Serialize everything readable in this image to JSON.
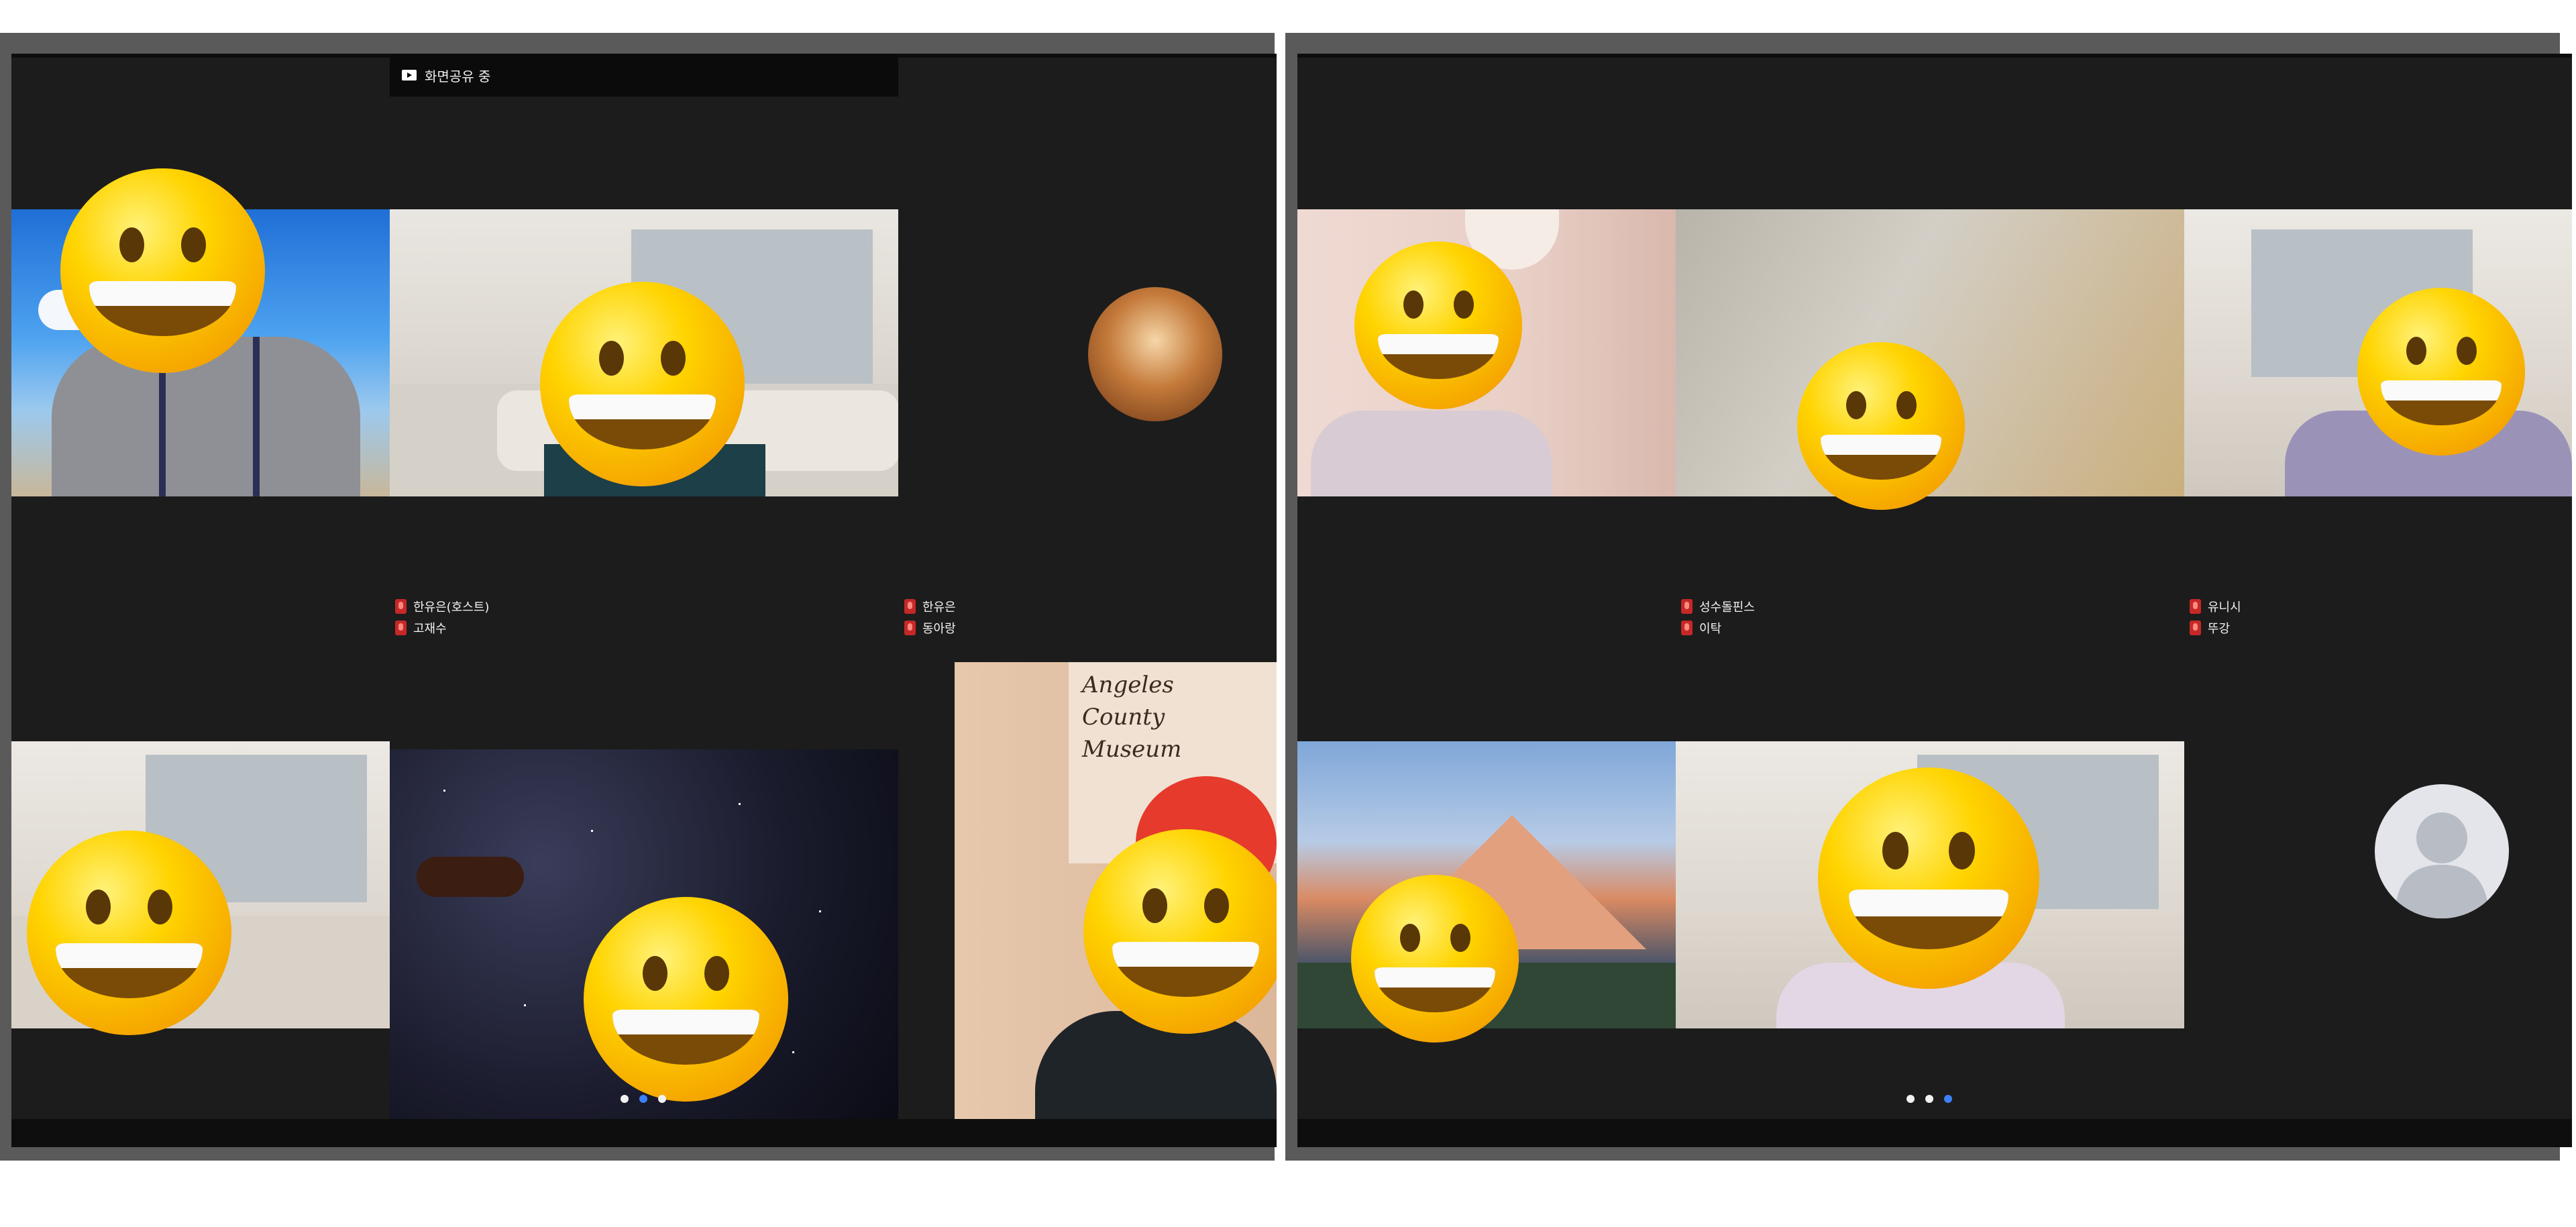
{
  "left_screen": {
    "share_banner": {
      "label": "화면공유 중",
      "icon": "screen-share-icon"
    },
    "name_groups": [
      {
        "names": [
          "한유은(호스트)",
          "고재수"
        ]
      },
      {
        "names": [
          "한유은",
          "동아랑"
        ]
      }
    ],
    "poster_text": "Angeles County Museum",
    "pager": {
      "count": 3,
      "active_index": 1
    }
  },
  "right_screen": {
    "name_groups": [
      {
        "names": [
          "성수돌핀스",
          "이탁"
        ]
      },
      {
        "names": [
          "유니시",
          "뚜강"
        ]
      }
    ],
    "placeholder_avatar": "person-silhouette-icon",
    "pager": {
      "count": 3,
      "active_index": 2
    }
  },
  "colors": {
    "background": "#1c1c1c",
    "frame": "#5a5a5a",
    "active_dot": "#3b82f6",
    "mic_red": "#c62828"
  }
}
